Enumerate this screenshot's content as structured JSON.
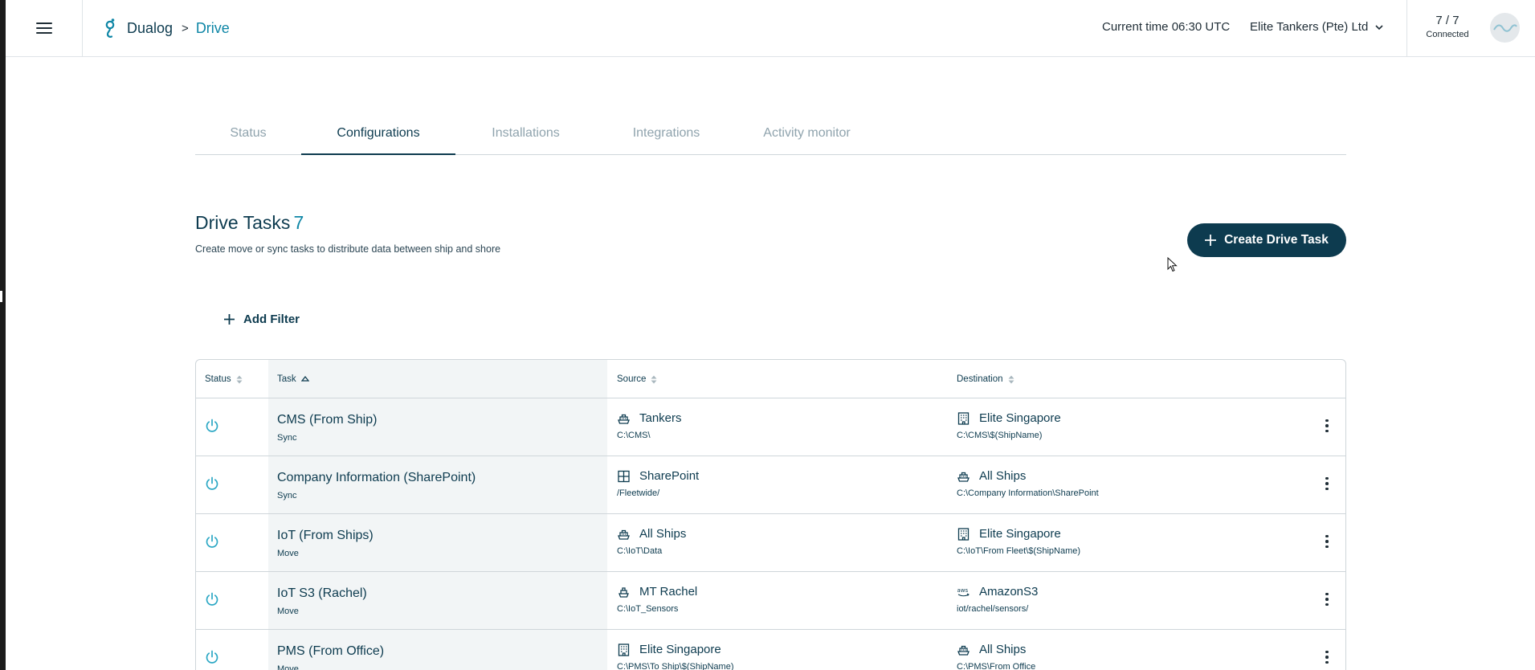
{
  "header": {
    "app_name": "Dualog",
    "breadcrumb_separator": ">",
    "section": "Drive",
    "current_time": "Current time 06:30 UTC",
    "company": "Elite Tankers (Pte) Ltd",
    "connection_count": "7 / 7",
    "connection_label": "Connected"
  },
  "tabs": [
    {
      "label": "Status",
      "active": false
    },
    {
      "label": "Configurations",
      "active": true
    },
    {
      "label": "Installations",
      "active": false
    },
    {
      "label": "Integrations",
      "active": false
    },
    {
      "label": "Activity monitor",
      "active": false
    }
  ],
  "page": {
    "title": "Drive Tasks",
    "count": "7",
    "subtitle": "Create move or sync tasks to distribute data between ship and shore",
    "create_button": "Create Drive Task",
    "add_filter": "Add Filter"
  },
  "table": {
    "columns": {
      "status": "Status",
      "task": "Task",
      "source": "Source",
      "destination": "Destination"
    },
    "rows": [
      {
        "task": "CMS (From Ship)",
        "type": "Sync",
        "source_icon": "ship-icon",
        "source": "Tankers",
        "source_path": "C:\\CMS\\",
        "dest_icon": "building-icon",
        "destination": "Elite Singapore",
        "dest_path": "C:\\CMS\\$(ShipName)"
      },
      {
        "task": "Company Information (SharePoint)",
        "type": "Sync",
        "source_icon": "sharepoint-grid-icon",
        "source": "SharePoint",
        "source_path": "/Fleetwide/",
        "dest_icon": "ship-icon",
        "destination": "All Ships",
        "dest_path": "C:\\Company Information\\SharePoint"
      },
      {
        "task": "IoT (From Ships)",
        "type": "Move",
        "source_icon": "ship-icon",
        "source": "All Ships",
        "source_path": "C:\\IoT\\Data",
        "dest_icon": "building-icon",
        "destination": "Elite Singapore",
        "dest_path": "C:\\IoT\\From Fleet\\$(ShipName)"
      },
      {
        "task": "IoT S3 (Rachel)",
        "type": "Move",
        "source_icon": "single-ship-icon",
        "source": "MT Rachel",
        "source_path": "C:\\IoT_Sensors",
        "dest_icon": "aws-icon",
        "destination": "AmazonS3",
        "dest_path": "iot/rachel/sensors/"
      },
      {
        "task": "PMS (From Office)",
        "type": "Move",
        "source_icon": "building-icon",
        "source": "Elite Singapore",
        "source_path": "C:\\PMS\\To Ship\\$(ShipName)",
        "dest_icon": "ship-icon",
        "destination": "All Ships",
        "dest_path": "C:\\PMS\\From Office"
      }
    ]
  },
  "colors": {
    "primary": "#0d3b4f",
    "accent": "#0e86a6",
    "status_icon": "#2aa7c4",
    "muted_tab": "#8fa3ad",
    "task_column_bg": "#f2f5f6"
  }
}
